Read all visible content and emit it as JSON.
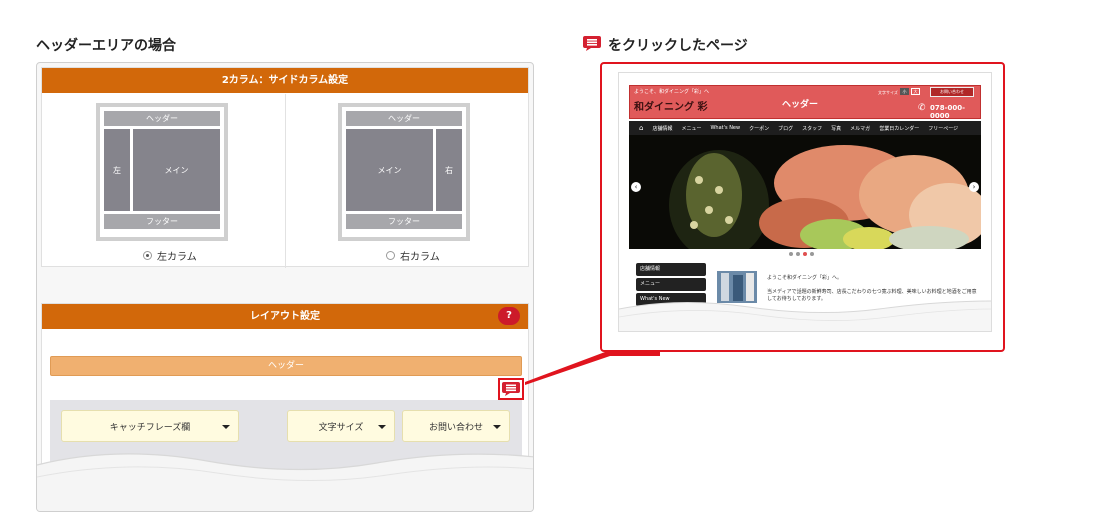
{
  "left_heading": "ヘッダーエリアの場合",
  "right_heading": "をクリックしたページ",
  "column_section": {
    "title": "2カラム：サイドカラム設定",
    "left_layout": {
      "header": "ヘッダー",
      "side": "左",
      "main": "メイン",
      "footer": "フッター",
      "radio_label": "左カラム",
      "selected": true
    },
    "right_layout": {
      "header": "ヘッダー",
      "side": "右",
      "main": "メイン",
      "footer": "フッター",
      "radio_label": "右カラム",
      "selected": false
    }
  },
  "layout_section": {
    "title": "レイアウト設定",
    "help_label": "?",
    "header_bar": "ヘッダー",
    "dropdowns": [
      "キャッチフレーズ欄",
      "文字サイズ",
      "お問い合わせ"
    ]
  },
  "preview": {
    "welcome": "ようこそ、和ダイニング「彩」へ",
    "logo": "和ダイニング 彩",
    "header_label": "ヘッダー",
    "font_size_label": "文字サイズ",
    "size_small": "小",
    "size_large": "大",
    "contact_btn": "お問い合わせ",
    "phone": "078-000-0000",
    "nav": [
      "店舗情報",
      "メニュー",
      "What's New",
      "クーポン",
      "ブログ",
      "スタッフ",
      "写真",
      "メルマガ",
      "営業日カレンダー",
      "フリーページ"
    ],
    "side_menu": [
      "店舗情報",
      "メニュー",
      "What's New"
    ],
    "intro_title": "ようこそ和ダイニング「彩」へ。",
    "intro_text_1": "当メディアで話題の新鮮寿司、店長こだわりの七つ寛ぶ料理、美味しいお料理と地酒をご用意",
    "intro_text_2": "してお待ちしております。"
  },
  "colors": {
    "orange": "#d2680a",
    "header_bar": "#f0b070",
    "red": "#e0141e",
    "preview_header": "#e05a5a"
  }
}
